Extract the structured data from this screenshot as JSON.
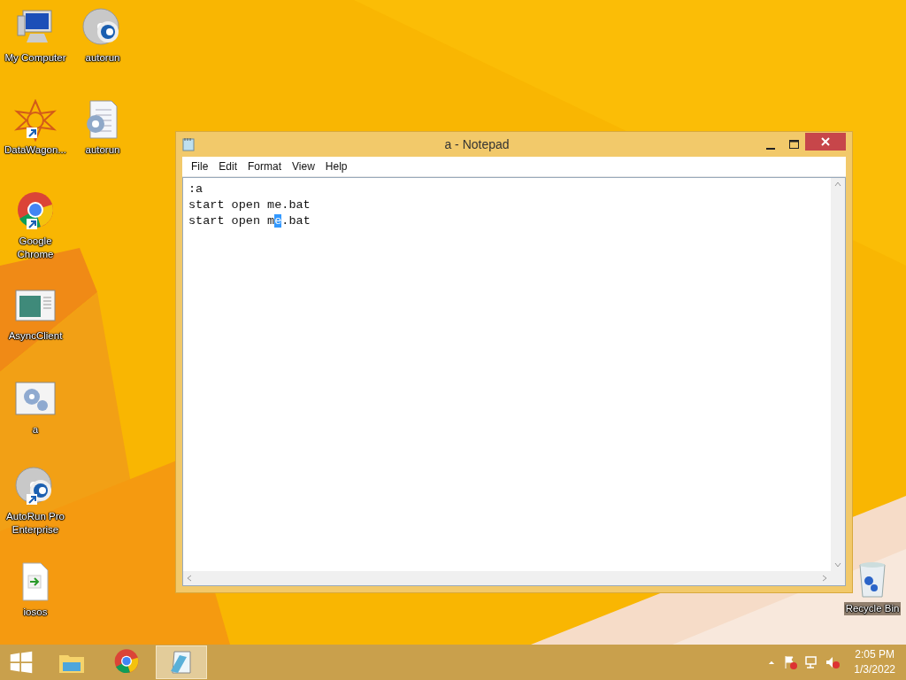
{
  "desktop_icons": [
    {
      "label": "My Computer",
      "kind": "computer",
      "shortcut": false
    },
    {
      "label": "autorun",
      "kind": "disc",
      "shortcut": false
    },
    {
      "label": "DataWagon...",
      "kind": "star",
      "shortcut": true
    },
    {
      "label": "autorun",
      "kind": "config",
      "shortcut": false
    },
    {
      "label": "Google Chrome",
      "kind": "chrome",
      "shortcut": true
    },
    {
      "label": "AsyncClient",
      "kind": "app",
      "shortcut": false
    },
    {
      "label": "a",
      "kind": "gears",
      "shortcut": false
    },
    {
      "label": "AutoRun Pro Enterprise",
      "kind": "disc",
      "shortcut": true
    },
    {
      "label": "iosos",
      "kind": "file",
      "shortcut": false
    },
    {
      "label": "Recycle Bin",
      "kind": "bin",
      "shortcut": false
    }
  ],
  "window": {
    "title": "a - Notepad",
    "menu": [
      "File",
      "Edit",
      "Format",
      "View",
      "Help"
    ],
    "lines": [
      [
        {
          "text": ":a",
          "selected": false
        }
      ],
      [
        {
          "text": "start open me.bat",
          "selected": false
        }
      ],
      [
        {
          "text": "start open m",
          "selected": false
        },
        {
          "text": "e",
          "selected": true
        },
        {
          "text": ".bat",
          "selected": false
        }
      ]
    ]
  },
  "taskbar": {
    "items": [
      {
        "kind": "explorer",
        "selected": false
      },
      {
        "kind": "chrome",
        "selected": false
      },
      {
        "kind": "notepad",
        "selected": true
      }
    ],
    "time": "2:05 PM",
    "date": "1/3/2022"
  }
}
